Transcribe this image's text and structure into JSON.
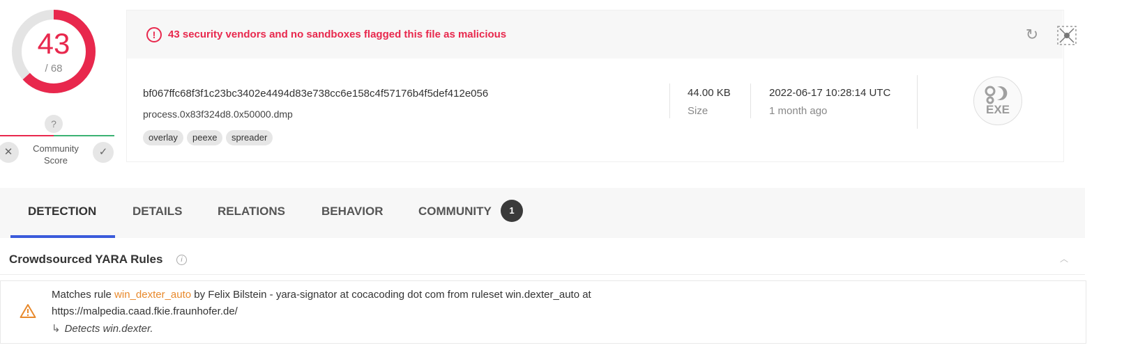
{
  "score": {
    "detections": "43",
    "total": "/ 68",
    "ratio": 0.632,
    "ring_color": "#e8284d",
    "track_color": "#d9d9d9"
  },
  "community_score": {
    "value": "?",
    "label": "Community Score",
    "downvote_icon": "close-icon",
    "upvote_icon": "check-icon"
  },
  "banner": {
    "icon": "alert-circle-icon",
    "message": "43 security vendors and no sandboxes flagged this file as malicious",
    "accent_color": "#e8284d",
    "actions": [
      "reanalyze-icon",
      "similar-graph-icon"
    ]
  },
  "file": {
    "hash": "bf067ffc68f3f1c23bc3402e4494d83e738cc6e158c4f57176b4f5def412e056",
    "name": "process.0x83f324d8.0x50000.dmp",
    "tags": [
      "overlay",
      "peexe",
      "spreader"
    ],
    "size_value": "44.00 KB",
    "size_label": "Size",
    "date_value": "2022-06-17 10:28:14 UTC",
    "date_relative": "1 month ago",
    "type_icon_label": "EXE"
  },
  "tabs": [
    {
      "label": "DETECTION",
      "active": true
    },
    {
      "label": "DETAILS"
    },
    {
      "label": "RELATIONS"
    },
    {
      "label": "BEHAVIOR"
    },
    {
      "label": "COMMUNITY",
      "badge": "1"
    }
  ],
  "yara": {
    "title": "Crowdsourced YARA Rules",
    "rule": {
      "prefix": "Matches rule ",
      "name": "win_dexter_auto",
      "suffix": " by Felix Bilstein - yara-signator at cocacoding dot com from ruleset win.dexter_auto at",
      "source_url": "https://malpedia.caad.fkie.fraunhofer.de/",
      "arrow": "↳",
      "description": "Detects win.dexter.",
      "highlight_color": "#e8892c"
    }
  }
}
